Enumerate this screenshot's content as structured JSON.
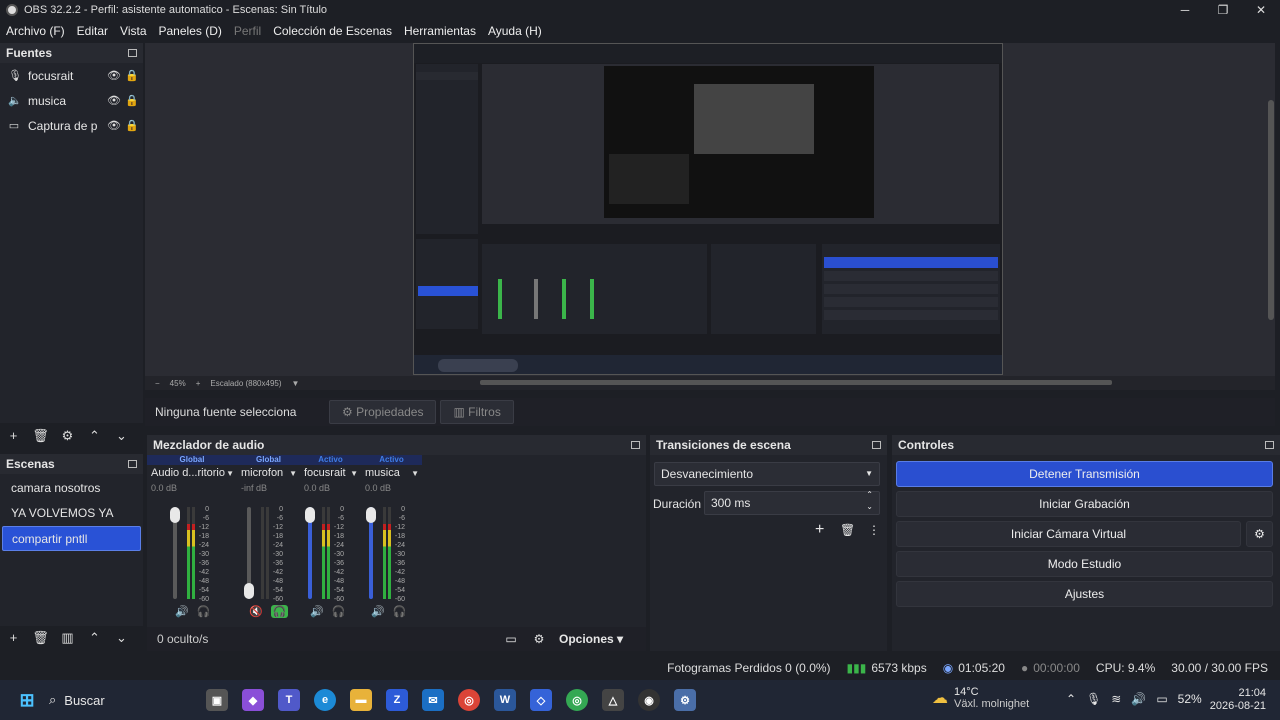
{
  "window": {
    "title": "OBS 32.2.2 - Perfil: asistente automatico - Escenas: Sin Título",
    "minimize": "─",
    "maximize": "❐",
    "close": "✕"
  },
  "menu": [
    "Archivo (F)",
    "Editar",
    "Vista",
    "Paneles (D)",
    "Perfil",
    "Colección de Escenas",
    "Herramientas",
    "Ayuda (H)"
  ],
  "sources": {
    "title": "Fuentes",
    "items": [
      {
        "label": "focusrait",
        "icon": "mic-icon"
      },
      {
        "label": "musica",
        "icon": "speaker-icon"
      },
      {
        "label": "Captura de p",
        "icon": "monitor-icon"
      }
    ]
  },
  "preview": {
    "zoom": "45%",
    "scale": "Escalado (880x495)"
  },
  "context": {
    "no_selection": "Ninguna fuente selecciona",
    "properties": "Propiedades",
    "filters": "Filtros"
  },
  "scenes": {
    "title": "Escenas",
    "items": [
      "camara nosotros",
      "YA VOLVEMOS YA",
      "compartir pntll"
    ],
    "selected": 2
  },
  "mixer": {
    "title": "Mezclador de audio",
    "channels": [
      {
        "tag": "Global",
        "name": "Audio d...ritorio",
        "db": "0.0 dB",
        "level": 0.82
      },
      {
        "tag": "Global",
        "name": "microfon",
        "db": "-inf dB",
        "level": 0.0
      },
      {
        "tag": "Activo",
        "name": "focusrait",
        "db": "0.0 dB",
        "level": 0.82
      },
      {
        "tag": "Activo",
        "name": "musica",
        "db": "0.0 dB",
        "level": 0.82
      }
    ],
    "scale": [
      "0",
      "-6",
      "-12",
      "-18",
      "-24",
      "-30",
      "-36",
      "-42",
      "-48",
      "-54",
      "-60"
    ],
    "hidden": "0 oculto/s",
    "options": "Opciones"
  },
  "transitions": {
    "title": "Transiciones de escena",
    "type": "Desvanecimiento",
    "duration_label": "Duración",
    "duration": "300 ms"
  },
  "controls": {
    "title": "Controles",
    "stream": "Detener Transmisión",
    "record": "Iniciar Grabación",
    "virtualcam": "Iniciar Cámara Virtual",
    "studio": "Modo Estudio",
    "settings": "Ajustes"
  },
  "status": {
    "dropped": "Fotogramas Perdidos 0 (0.0%)",
    "kbps": "6573 kbps",
    "stream_time": "01:05:20",
    "rec_time": "00:00:00",
    "cpu": "CPU: 9.4%",
    "fps": "30.00 / 30.00 FPS"
  },
  "taskbar": {
    "search": "Buscar",
    "weather_temp": "14°C",
    "weather_desc": "Växl. molnighet",
    "battery": "52%",
    "time": "21:04",
    "date": "2026-08-21"
  },
  "colors": {
    "accent": "#2a4fd0",
    "bg": "#1d1f25",
    "panel": "#22242b"
  }
}
